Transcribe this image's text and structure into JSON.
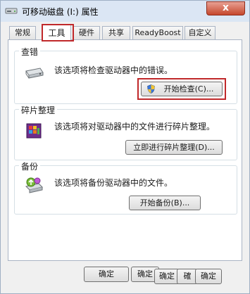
{
  "window": {
    "title": "可移动磁盘 (I:) 属性",
    "close_glyph": "x"
  },
  "tabs": [
    {
      "label": "常规",
      "active": false
    },
    {
      "label": "工具",
      "active": true
    },
    {
      "label": "硬件",
      "active": false
    },
    {
      "label": "共享",
      "active": false
    },
    {
      "label": "ReadyBoost",
      "active": false
    },
    {
      "label": "自定义",
      "active": false
    }
  ],
  "groups": {
    "error_check": {
      "title": "查错",
      "description": "该选项将检查驱动器中的错误。",
      "button_label": "开始检查(C)..."
    },
    "defrag": {
      "title": "碎片整理",
      "description": "该选项将对驱动器中的文件进行碎片整理。",
      "button_label": "立即进行碎片整理(D)..."
    },
    "backup": {
      "title": "备份",
      "description": "该选项将备份驱动器中的文件。",
      "button_label": "开始备份(B)..."
    }
  },
  "footer": {
    "buttons": [
      "确定",
      "确定",
      "确定",
      "確",
      "确定"
    ]
  },
  "colors": {
    "highlight": "#c0282a",
    "titlebar": "#dbe6f4",
    "close_button": "#c6482d"
  }
}
